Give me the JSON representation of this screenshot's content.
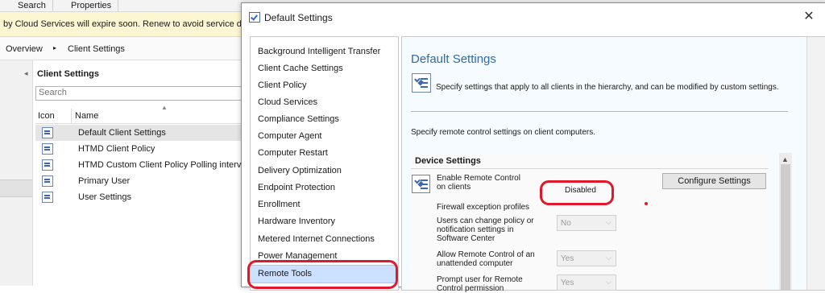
{
  "console": {
    "tabs": [
      "Search",
      "Properties"
    ],
    "notification": "by Cloud Services will expire soon. Renew to avoid service di",
    "breadcrumb": {
      "item1": "Overview",
      "separator": "▸",
      "item2": "Client Settings"
    },
    "list": {
      "title": "Client Settings",
      "search_placeholder": "Search",
      "columns": {
        "icon": "Icon",
        "name": "Name"
      },
      "rows": [
        {
          "name": "Default Client Settings"
        },
        {
          "name": "HTMD Client Policy"
        },
        {
          "name": "HTMD Custom Client Policy Polling interv"
        },
        {
          "name": "Primary User"
        },
        {
          "name": "User Settings"
        }
      ]
    }
  },
  "dialog": {
    "title": "Default Settings",
    "close_glyph": "✕",
    "nav": [
      "Background Intelligent Transfer",
      "Client Cache Settings",
      "Client Policy",
      "Cloud Services",
      "Compliance Settings",
      "Computer Agent",
      "Computer Restart",
      "Delivery Optimization",
      "Endpoint Protection",
      "Enrollment",
      "Hardware Inventory",
      "Metered Internet Connections",
      "Power Management",
      "Remote Tools"
    ],
    "selected_nav": "Remote Tools",
    "content": {
      "heading": "Default Settings",
      "description": "Specify settings that apply to all clients in the hierarchy, and can be modified by custom settings.",
      "section_description": "Specify remote control settings on client computers.",
      "device_settings": {
        "header": "Device Settings",
        "enable_label": "Enable Remote Control on clients",
        "enable_value": "Disabled",
        "configure_button": "Configure Settings",
        "firewall_label": "Firewall exception profiles",
        "users_change_label": "Users can change policy or notification settings in Software Center",
        "users_change_value": "No",
        "allow_unattended_label": "Allow Remote Control of an unattended computer",
        "allow_unattended_value": "Yes",
        "prompt_label": "Prompt user for Remote Control permission",
        "prompt_value": "Yes"
      }
    }
  },
  "colors": {
    "accent": "#2e6aa8",
    "highlight": "#e0182c",
    "notification_bg": "#fdf6d3",
    "selection": "#cce0ff"
  }
}
